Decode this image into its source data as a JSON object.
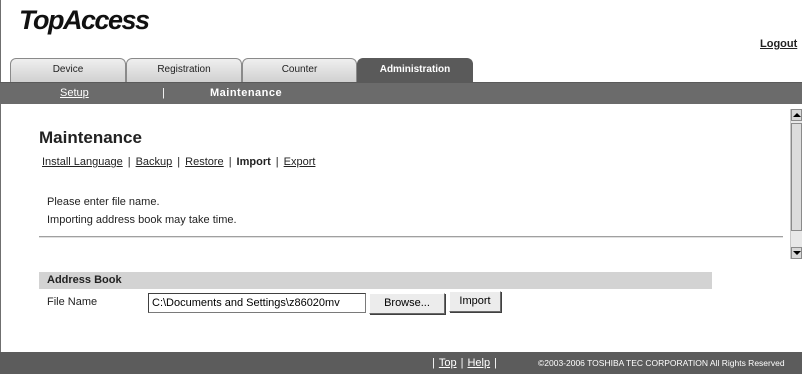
{
  "header": {
    "logo": "TopAccess",
    "logout_label": "Logout"
  },
  "tabs": [
    {
      "label": "Device"
    },
    {
      "label": "Registration"
    },
    {
      "label": "Counter"
    },
    {
      "label": "Administration",
      "active": true
    }
  ],
  "subnav": {
    "setup": "Setup",
    "separator": "|",
    "current": "Maintenance"
  },
  "page": {
    "title": "Maintenance",
    "task_links": [
      "Install Language",
      "Backup",
      "Restore",
      "Import",
      "Export"
    ],
    "current_task": "Import",
    "link_separator": "|",
    "messages": [
      "Please enter file name.",
      "Importing address book may take time."
    ]
  },
  "address_book": {
    "section_title": "Address Book",
    "file_label": "File Name",
    "file_value": "C:\\Documents and Settings\\z86020mv",
    "browse_label": "Browse...",
    "import_label": "Import"
  },
  "footer": {
    "top_label": "Top",
    "help_label": "Help",
    "separator": "|",
    "copyright": "©2003-2006 TOSHIBA TEC CORPORATION All Rights Reserved"
  },
  "colors": {
    "nav_bar": "#6b6b6b",
    "active_tab": "#5a5a5a",
    "section_header": "#d3d3d3",
    "footer": "#5c5c5c"
  }
}
